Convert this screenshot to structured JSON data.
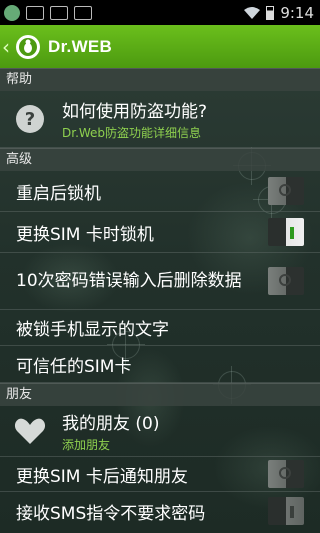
{
  "status_bar": {
    "time": "9:14"
  },
  "action_bar": {
    "title": "Dr.WEB"
  },
  "sections": {
    "help": {
      "header": "帮助",
      "item_title": "如何使用防盗功能?",
      "item_subtitle": "Dr.Web防盗功能详细信息"
    },
    "advanced": {
      "header": "高级",
      "items": [
        {
          "label": "重启后锁机",
          "toggle": "off"
        },
        {
          "label": "更换SIM 卡时锁机",
          "toggle": "on"
        },
        {
          "label": "10次密码错误输入后删除数据",
          "toggle": "off"
        },
        {
          "label": "被锁手机显示的文字"
        },
        {
          "label": "可信任的SIM卡"
        }
      ]
    },
    "friends": {
      "header": "朋友",
      "item_title": "我的朋友 (0)",
      "item_subtitle": "添加朋友",
      "items": [
        {
          "label": "更换SIM 卡后通知朋友",
          "toggle": "off"
        },
        {
          "label": "接收SMS指令不要求密码",
          "toggle": "off"
        }
      ]
    }
  },
  "colors": {
    "accent": "#5cae14",
    "link": "#8fd14f"
  }
}
